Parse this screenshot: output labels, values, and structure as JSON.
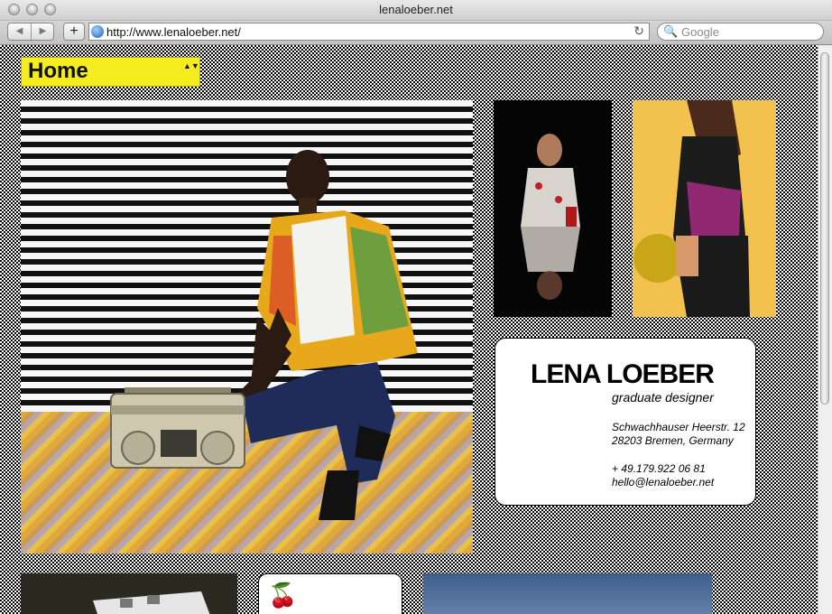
{
  "window": {
    "title": "lenaloeber.net"
  },
  "toolbar": {
    "back_icon": "◀",
    "forward_icon": "▶",
    "add_icon": "+",
    "url": "http://www.lenaloeber.net/",
    "reload_icon": "↻",
    "search_placeholder": "Google",
    "search_icon": "🔍"
  },
  "page": {
    "nav": {
      "selected": "Home",
      "arrows": "▲▼"
    },
    "card": {
      "name": "LENA LOEBER",
      "role": "graduate designer",
      "address_line1": "Schwachhauser Heerstr. 12",
      "address_line2": "28203 Bremen, Germany",
      "phone": "+ 49.179.922 06 81",
      "email": "hello@lenaloeber.net"
    },
    "cherry_icon": "🍒"
  },
  "colors": {
    "nav_yellow": "#f4ec1f",
    "thumb_yellow": "#f3c24e"
  }
}
